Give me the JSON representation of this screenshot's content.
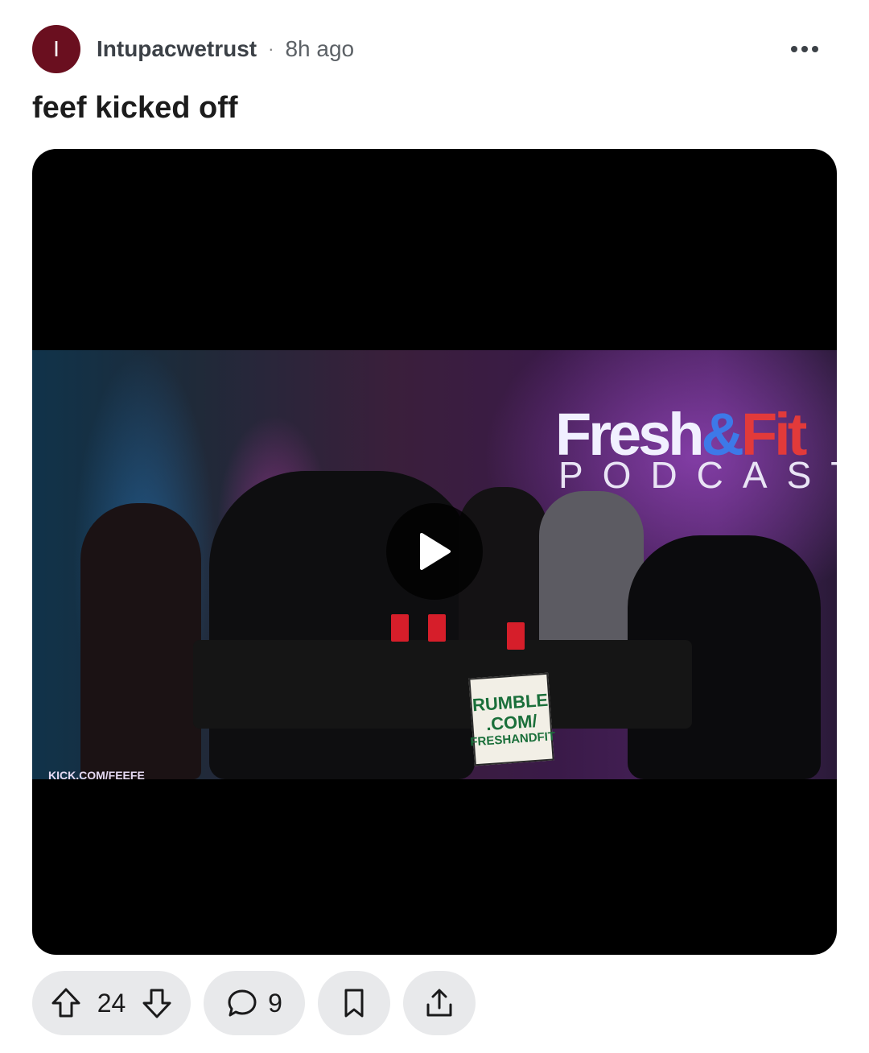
{
  "post": {
    "author": {
      "avatar_letter": "I",
      "avatar_color": "#6a0f1f",
      "username": "Intupacwetrust",
      "separator": "·",
      "time_ago": "8h ago"
    },
    "more_icon": "more-horizontal-icon",
    "title": "feef kicked off"
  },
  "video": {
    "scene": {
      "logo_fresh": "Fresh",
      "logo_amp": "&",
      "logo_fit": "Fit",
      "logo_sub": "PODCAST",
      "sign_line1": "RUMBLE",
      "sign_line2": ".COM/",
      "sign_line3": "FRESHANDFIT",
      "watermark": "KICK.COM/FEEFE"
    },
    "play_icon": "play-icon"
  },
  "actions": {
    "upvote_icon": "arrow-up-icon",
    "score": "24",
    "downvote_icon": "arrow-down-icon",
    "comment_icon": "comment-icon",
    "comment_count": "9",
    "save_icon": "bookmark-icon",
    "share_icon": "share-icon"
  }
}
